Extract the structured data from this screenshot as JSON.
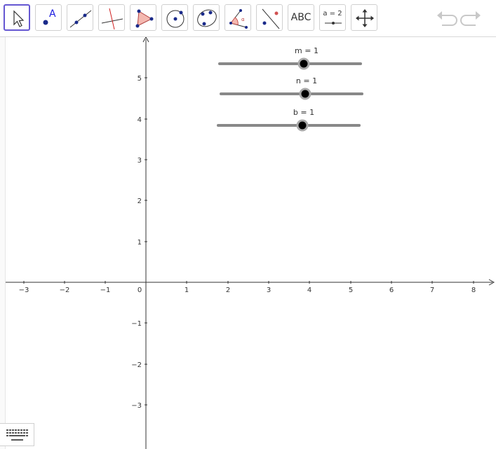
{
  "toolbar": {
    "tools": [
      {
        "name": "move",
        "icon": "arrow-cursor-icon",
        "active": true
      },
      {
        "name": "point",
        "icon": "point-icon",
        "label": "A"
      },
      {
        "name": "line",
        "icon": "line-through-points-icon"
      },
      {
        "name": "perpendicular",
        "icon": "perpendicular-line-icon"
      },
      {
        "name": "polygon",
        "icon": "polygon-icon"
      },
      {
        "name": "circle",
        "icon": "circle-center-point-icon"
      },
      {
        "name": "conic",
        "icon": "ellipse-icon"
      },
      {
        "name": "angle",
        "icon": "angle-icon"
      },
      {
        "name": "reflect",
        "icon": "reflect-icon"
      },
      {
        "name": "text",
        "icon": "text-icon",
        "label": "ABC"
      },
      {
        "name": "slider",
        "icon": "slider-icon",
        "label": "a = 2"
      },
      {
        "name": "move-graphics",
        "icon": "move-graphics-icon"
      }
    ],
    "undo_icon": "undo-icon",
    "redo_icon": "redo-icon"
  },
  "sliders": [
    {
      "name": "m",
      "label": "m = 1",
      "value": 1
    },
    {
      "name": "n",
      "label": "n = 1",
      "value": 1
    },
    {
      "name": "b",
      "label": "b = 1",
      "value": 1
    }
  ],
  "axes": {
    "x_ticks": [
      "−3",
      "−2",
      "−1",
      "0",
      "1",
      "2",
      "3",
      "4",
      "5",
      "6",
      "7",
      "8"
    ],
    "y_ticks": [
      "5",
      "4",
      "3",
      "2",
      "1",
      "−1",
      "−2",
      "−3"
    ]
  },
  "keyboard": {
    "icon": "keyboard-icon"
  }
}
